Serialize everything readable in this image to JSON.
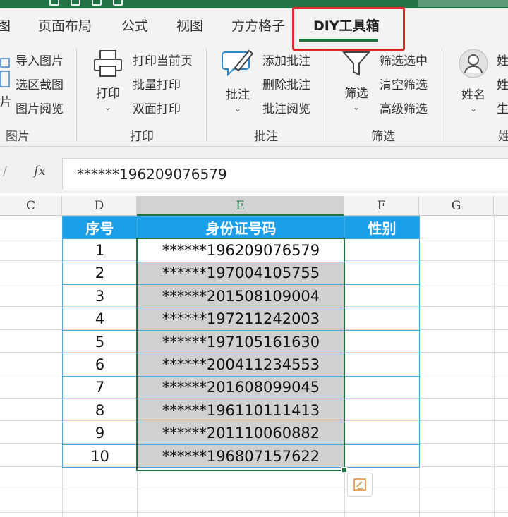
{
  "tabs": [
    {
      "label": "图"
    },
    {
      "label": "页面布局"
    },
    {
      "label": "公式"
    },
    {
      "label": "视图"
    },
    {
      "label": "方方格子"
    },
    {
      "label": "DIY工具箱"
    }
  ],
  "ribbon": {
    "picture_group": {
      "items": [
        "导入图片",
        "选区截图",
        "图片阅览"
      ],
      "partial_label": "片",
      "label": "图片"
    },
    "print_group": {
      "big_label": "打印",
      "items": [
        "打印当前页",
        "批量打印",
        "双面打印"
      ],
      "label": "打印"
    },
    "comment_group": {
      "big_label": "批注",
      "items": [
        "添加批注",
        "删除批注",
        "批注阅览"
      ],
      "label": "批注"
    },
    "filter_group": {
      "big_label": "筛选",
      "items": [
        "筛选选中",
        "清空筛选",
        "高级筛选"
      ],
      "label": "筛选"
    },
    "name_group": {
      "big_label": "姓名",
      "items": [
        "姓",
        "姓",
        "生"
      ],
      "label": "姓"
    }
  },
  "formula_bar": {
    "fx": "fx",
    "value": "******196209076579"
  },
  "columns": [
    "C",
    "D",
    "E",
    "F",
    "G"
  ],
  "table": {
    "headers": [
      "序号",
      "身份证号码",
      "性别"
    ],
    "rows": [
      {
        "no": "1",
        "id": "******196209076579",
        "gender": ""
      },
      {
        "no": "2",
        "id": "******197004105755",
        "gender": ""
      },
      {
        "no": "3",
        "id": "******201508109004",
        "gender": ""
      },
      {
        "no": "4",
        "id": "******197211242003",
        "gender": ""
      },
      {
        "no": "5",
        "id": "******197105161630",
        "gender": ""
      },
      {
        "no": "6",
        "id": "******200411234553",
        "gender": ""
      },
      {
        "no": "7",
        "id": "******201608099045",
        "gender": ""
      },
      {
        "no": "8",
        "id": "******196110111413",
        "gender": ""
      },
      {
        "no": "9",
        "id": "******201110060882",
        "gender": ""
      },
      {
        "no": "10",
        "id": "******196807157622",
        "gender": ""
      }
    ]
  },
  "colors": {
    "accent": "#217346",
    "header_blue": "#1a9ee8",
    "highlight_red": "#e0282e",
    "selection_gray": "#d0d0d0"
  }
}
